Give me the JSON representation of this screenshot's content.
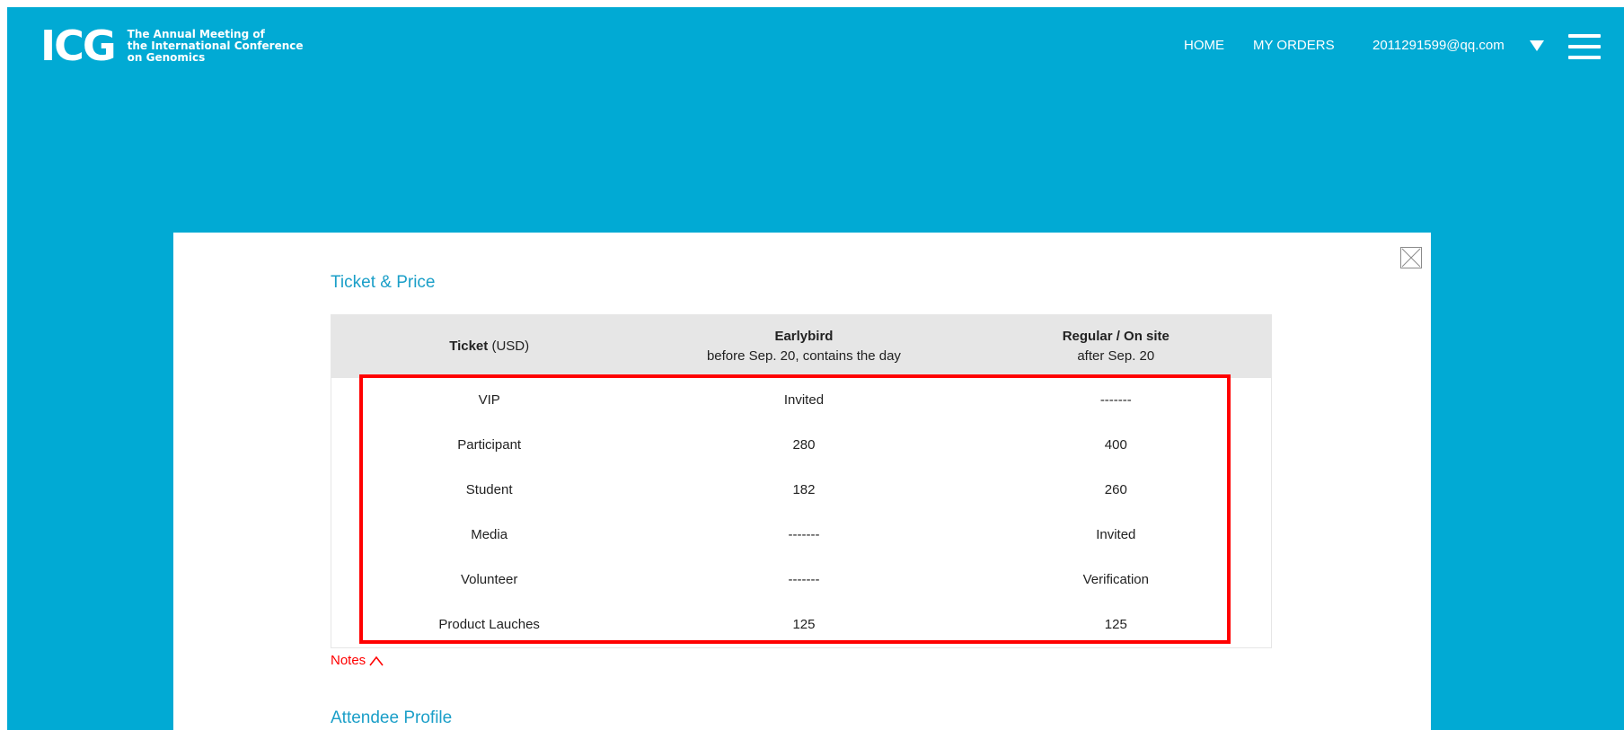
{
  "header": {
    "logo_mark": "ICG",
    "logo_lines": [
      "The Annual Meeting of",
      "the International Conference",
      "on Genomics"
    ],
    "nav": {
      "home": "HOME",
      "orders": "MY ORDERS",
      "email": "2011291599@qq.com"
    },
    "icons": [
      "caret-down-icon",
      "hamburger-menu-icon"
    ]
  },
  "modal": {
    "close_icon": "close-icon",
    "section_title": "Ticket & Price",
    "table": {
      "headers": [
        {
          "bold": "Ticket",
          "rest": " (USD)",
          "sub": ""
        },
        {
          "bold": "Earlybird",
          "rest": "",
          "sub": "before Sep. 20, contains the day"
        },
        {
          "bold": "Regular / On site",
          "rest": "",
          "sub": "after Sep. 20"
        }
      ],
      "rows": [
        [
          "VIP",
          "Invited",
          "-------"
        ],
        [
          "Participant",
          "280",
          "400"
        ],
        [
          "Student",
          "182",
          "260"
        ],
        [
          "Media",
          "-------",
          "Invited"
        ],
        [
          "Volunteer",
          "-------",
          "Verification"
        ],
        [
          "Product Lauches",
          "125",
          "125"
        ]
      ]
    },
    "notes_label": "Notes",
    "notes_icon": "chevron-up-icon",
    "next_section_title": "Attendee Profile"
  },
  "colors": {
    "background": "#01aad4",
    "title": "#1b9fc8",
    "highlight": "#ff0000",
    "header_row": "#e6e6e6"
  }
}
